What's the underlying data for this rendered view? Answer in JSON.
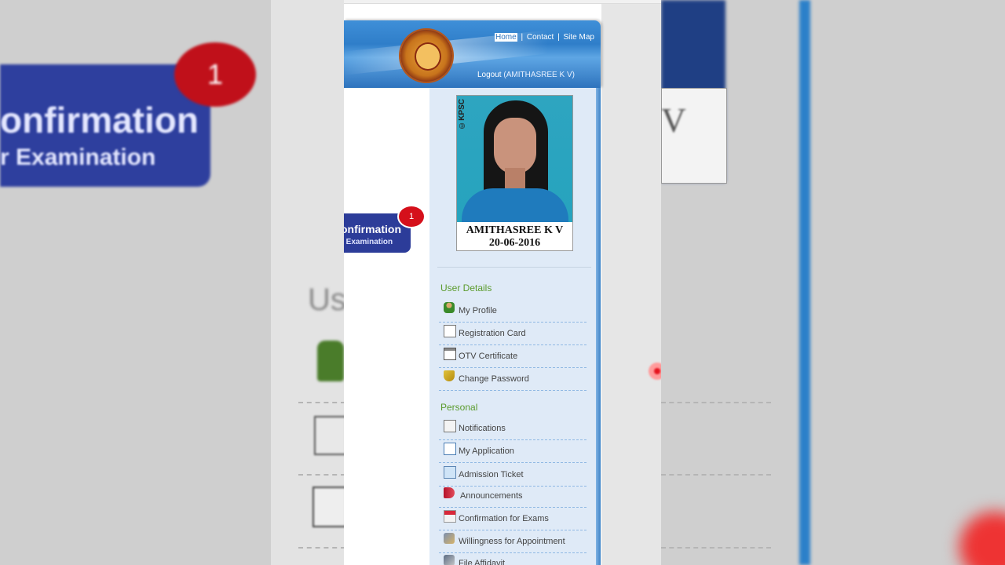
{
  "background": {
    "banner_line1": "onfirmation",
    "banner_line2": "r Examination",
    "badge_count": "1",
    "partial_heading": "Us",
    "right_letter": "V"
  },
  "header": {
    "links": {
      "home": "Home",
      "contact": "Contact",
      "sitemap": "Site Map",
      "separator": "|"
    },
    "logout_label": "Logout",
    "logged_user": "(AMITHASREE K V)"
  },
  "promo": {
    "line1": "onfirmation",
    "line2": "r Examination",
    "badge": "1"
  },
  "profile": {
    "watermark": "©KPSC",
    "name": "AMITHASREE K V",
    "date": "20-06-2016"
  },
  "sidebar": {
    "sections": [
      {
        "title": "User Details",
        "items": [
          {
            "label": "My Profile",
            "icon": "user-icon"
          },
          {
            "label": "Registration Card",
            "icon": "card-icon"
          },
          {
            "label": "OTV Certificate",
            "icon": "certificate-icon"
          },
          {
            "label": "Change Password",
            "icon": "shield-icon"
          }
        ]
      },
      {
        "title": "Personal",
        "items": [
          {
            "label": "Notifications",
            "icon": "envelope-icon"
          },
          {
            "label": "My Application",
            "icon": "edit-icon"
          },
          {
            "label": "Admission Ticket",
            "icon": "ticket-icon"
          },
          {
            "label": "Announcements",
            "icon": "megaphone-icon"
          },
          {
            "label": "Confirmation for Exams",
            "icon": "calendar-icon"
          },
          {
            "label": "Willingness for Appointment",
            "icon": "handshake-icon"
          },
          {
            "label": "File Affidavit",
            "icon": "pen-icon"
          }
        ]
      }
    ]
  },
  "colors": {
    "header_blue": "#2f7ec9",
    "sidebar_bg": "#dfeaf7",
    "section_green": "#5b9b2d",
    "banner_navy": "#2c3c99",
    "badge_red": "#d5101b"
  }
}
